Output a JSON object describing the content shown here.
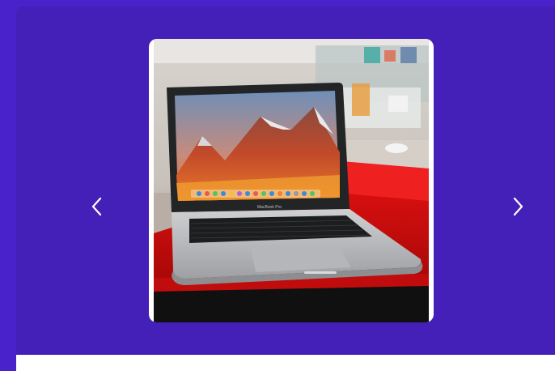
{
  "carousel": {
    "prev_icon": "chevron-left-icon",
    "next_icon": "chevron-right-icon",
    "image_subject": "laptop-photo",
    "screen_brand_text": "MacBook Pro"
  },
  "colors": {
    "background": "#4a22cc",
    "card": "#4420b8",
    "frame": "#ffffff",
    "arrow": "#ffffff"
  }
}
